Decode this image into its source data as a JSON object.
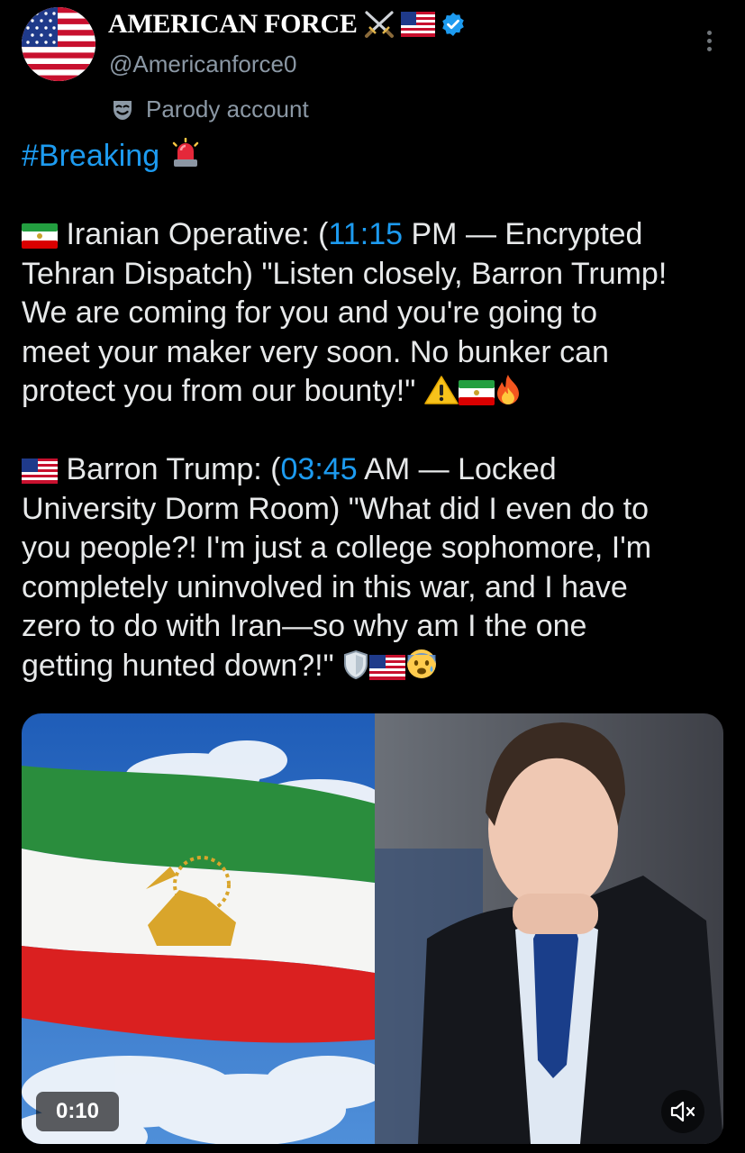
{
  "author": {
    "name": "AMERICAN FORCE",
    "handle": "@Americanforce0",
    "label": "Parody account",
    "avatar_icon": "us-flag-icon",
    "verified_color": "#1d9bf0"
  },
  "post": {
    "hashtag": "#Breaking",
    "lines": [
      {
        "pre": " Iranian Operative: (",
        "link": "11:15",
        "post": " PM — Encrypted"
      },
      {
        "text": "Tehran Dispatch) \"Listen closely, Barron Trump!"
      },
      {
        "text": "We are coming for you and you're going to"
      },
      {
        "text": "meet your maker very soon. No bunker can"
      },
      {
        "text": "protect you from our bounty!\" "
      },
      {
        "pre": " Barron Trump: (",
        "link": "03:45",
        "post": " AM — Locked"
      },
      {
        "text": "University Dorm Room) \"What did I even do to"
      },
      {
        "text": "you people?! I'm just a college sophomore, I'm"
      },
      {
        "text": "completely uninvolved in this war, and I have"
      },
      {
        "text": "zero to do with Iran—so why am I the one"
      },
      {
        "text": "getting hunted down?!\" "
      }
    ],
    "emoji": [
      "siren-icon",
      "iran-lion-sun-flag-icon",
      "warning-icon",
      "fire-icon",
      "us-flag-icon",
      "shield-icon",
      "anxious-face-icon"
    ]
  },
  "video": {
    "duration": "0:10",
    "muted_icon": "speaker-muted-icon"
  },
  "colors": {
    "background": "#000000",
    "text": "#e7e9ea",
    "secondary": "#8b98a5",
    "link": "#1d9bf0"
  }
}
